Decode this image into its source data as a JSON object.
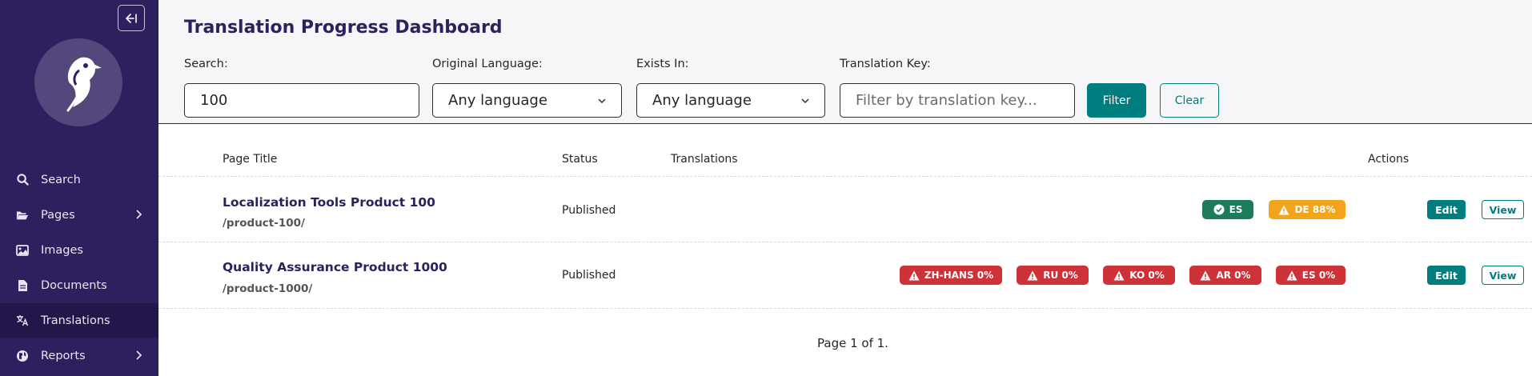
{
  "sidebar": {
    "collapse_icon": "collapse-left-icon",
    "items": [
      {
        "label": "Search",
        "icon": "search-icon"
      },
      {
        "label": "Pages",
        "icon": "folder-open-icon"
      },
      {
        "label": "Images",
        "icon": "image-icon"
      },
      {
        "label": "Documents",
        "icon": "document-icon"
      },
      {
        "label": "Translations",
        "icon": "language-icon"
      },
      {
        "label": "Reports",
        "icon": "globe-icon"
      }
    ]
  },
  "header": {
    "title": "Translation Progress Dashboard",
    "filters": {
      "search_label": "Search:",
      "search_value": "100",
      "original_language_label": "Original Language:",
      "original_language_value": "Any language",
      "exists_in_label": "Exists In:",
      "exists_in_value": "Any language",
      "translation_key_label": "Translation Key:",
      "translation_key_placeholder": "Filter by translation key...",
      "filter_button": "Filter",
      "clear_button": "Clear"
    }
  },
  "table": {
    "columns": [
      "Page Title",
      "Status",
      "Translations",
      "Actions"
    ],
    "rows": [
      {
        "title": "Localization Tools Product 100",
        "slug": "/product-100/",
        "status": "Published",
        "badges": [
          {
            "label": "ES",
            "kind": "complete"
          },
          {
            "label": "DE 88%",
            "kind": "partial"
          }
        ],
        "edit": "Edit",
        "view": "View"
      },
      {
        "title": "Quality Assurance Product 1000",
        "slug": "/product-1000/",
        "status": "Published",
        "badges": [
          {
            "label": "ZH-HANS 0%",
            "kind": "missing"
          },
          {
            "label": "RU 0%",
            "kind": "missing"
          },
          {
            "label": "KO 0%",
            "kind": "missing"
          },
          {
            "label": "AR 0%",
            "kind": "missing"
          },
          {
            "label": "ES 0%",
            "kind": "missing"
          }
        ],
        "edit": "Edit",
        "view": "View"
      }
    ]
  },
  "pagination": "Page 1 of 1.",
  "colors": {
    "sidebar_bg": "#2e1f5e",
    "accent_teal": "#007d7e",
    "badge_red": "#cd3238",
    "badge_green": "#1b7b5a",
    "badge_amber": "#f2a51a"
  }
}
